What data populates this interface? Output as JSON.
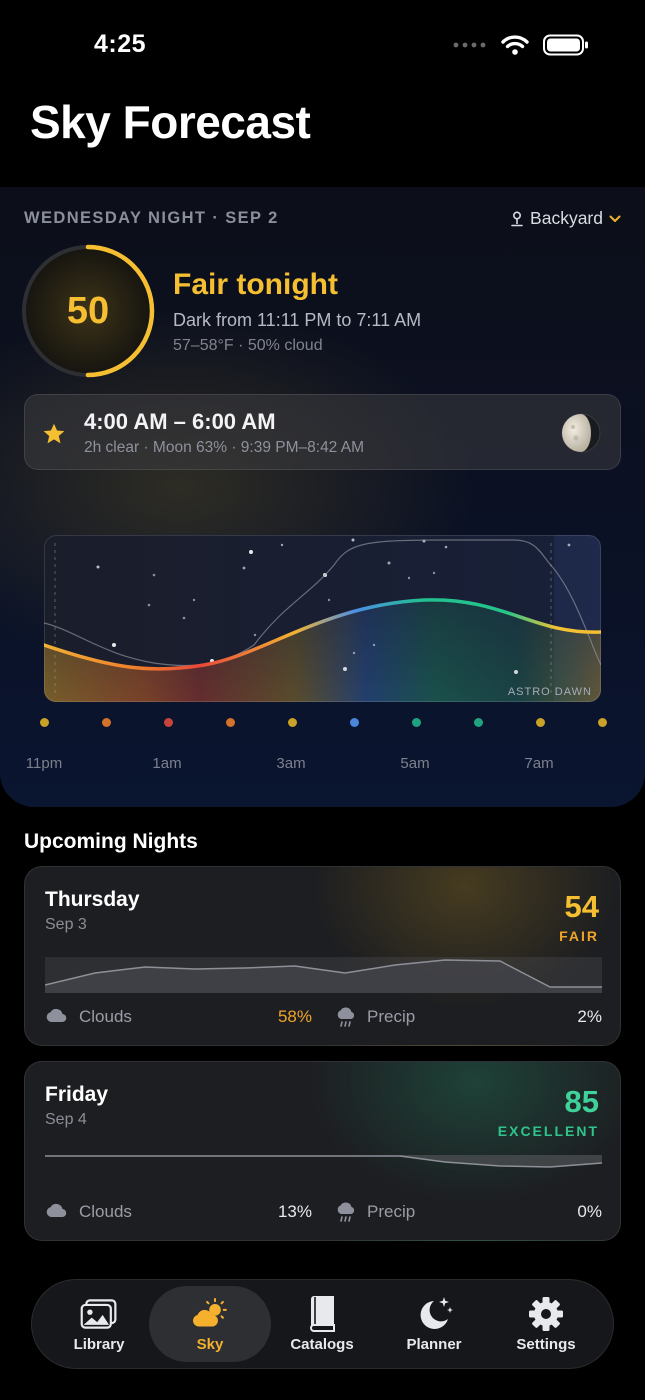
{
  "status": {
    "time": "4:25"
  },
  "title": "Sky Forecast",
  "hero": {
    "date": "WEDNESDAY NIGHT · SEP 2",
    "location": "Backyard",
    "score": "50",
    "score_fraction": 0.5,
    "headline": "Fair tonight",
    "dark_window": "Dark from 11:11 PM to 7:11 AM",
    "meta": "57–58°F  ·  50% cloud",
    "colors": {
      "accent": "#f5bf31"
    }
  },
  "best_window": {
    "time": "4:00 AM – 6:00 AM",
    "meta": "2h clear  ·  Moon 63%  ·  9:39 PM–8:42 AM",
    "icon": "star-icon",
    "moon_icon": "moon-phase-icon"
  },
  "chart_data": {
    "type": "line",
    "annotation": "ASTRO DAWN",
    "tick_labels": [
      "11pm",
      "1am",
      "3am",
      "5am",
      "7am"
    ],
    "quality_dot_colors": [
      "#c9a227",
      "#d4722a",
      "#c7443a",
      "#d4722a",
      "#c9a227",
      "#4a86d9",
      "#1fa37f",
      "#1fa37f",
      "#c9a227",
      "#c9a227"
    ]
  },
  "upcoming": {
    "title": "Upcoming Nights",
    "nights": [
      {
        "day": "Thursday",
        "date": "Sep 3",
        "score": "54",
        "rating": "FAIR",
        "color": "#f5bf31",
        "clouds_label": "Clouds",
        "clouds": "58%",
        "clouds_color": "#f0a52a",
        "precip_label": "Precip",
        "precip": "2%"
      },
      {
        "day": "Friday",
        "date": "Sep 4",
        "score": "85",
        "rating": "EXCELLENT",
        "color": "#3fd29b",
        "clouds_label": "Clouds",
        "clouds": "13%",
        "clouds_color": "#e8e9ec",
        "precip_label": "Precip",
        "precip": "0%"
      }
    ]
  },
  "tabs": [
    {
      "label": "Library",
      "icon": "photos-icon"
    },
    {
      "label": "Sky",
      "icon": "partly-sunny-icon",
      "active": true
    },
    {
      "label": "Catalogs",
      "icon": "book-icon"
    },
    {
      "label": "Planner",
      "icon": "moon-stars-icon"
    },
    {
      "label": "Settings",
      "icon": "gear-icon"
    }
  ]
}
